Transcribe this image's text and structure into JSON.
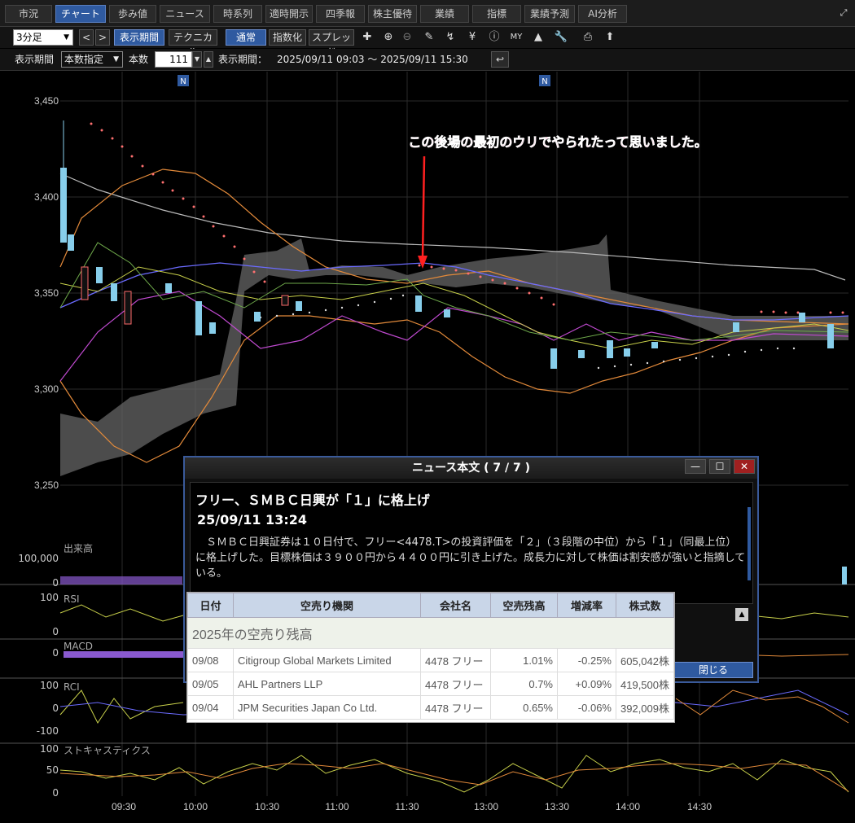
{
  "tabs": [
    "市況",
    "チャート",
    "歩み値",
    "ニュース",
    "時系列",
    "適時開示",
    "四季報",
    "株主優待",
    "業績",
    "指標",
    "業績予測",
    "AI分析"
  ],
  "active_tab": "チャート",
  "toolbar": {
    "interval": "3分足",
    "prev": "<",
    "next": ">",
    "period_btn": "表示期間",
    "technical_btn": "テクニカル",
    "normal_btn": "通常",
    "index_btn": "指数化",
    "spread_btn": "スプレッド"
  },
  "period_row": {
    "period_label": "表示期間",
    "mode": "本数指定",
    "count_label": "本数",
    "count_value": "111",
    "range_label": "表示期間：",
    "range_value": "2025/09/11 09:03 〜 2025/09/11 15:30"
  },
  "annotation": "この後場の最初のウリでやられたって思いました。",
  "news_marker": "N",
  "price_axis": {
    "ticks": [
      "3,450",
      "3,400",
      "3,350",
      "3,300",
      "3,250"
    ]
  },
  "panels": {
    "volume": {
      "label": "出来高",
      "ticks": [
        "100,000",
        "0"
      ]
    },
    "rsi": {
      "label": "RSI",
      "ticks": [
        "100",
        "0"
      ]
    },
    "macd": {
      "label": "MACD",
      "ticks": [
        "0"
      ]
    },
    "rci": {
      "label": "RCI",
      "ticks": [
        "100",
        "0",
        "-100"
      ]
    },
    "stoch": {
      "label": "ストキャスティクス",
      "ticks": [
        "100",
        "50",
        "0"
      ]
    }
  },
  "time_axis": [
    "09:30",
    "10:00",
    "10:30",
    "11:00",
    "11:30",
    "13:00",
    "13:30",
    "14:00",
    "14:30"
  ],
  "news": {
    "title": "ニュース本文 ( 7 / 7 )",
    "headline": "フリー、ＳＭＢＣ日興が「１」に格上げ",
    "date": "25/09/11 13:24",
    "body": "　ＳＭＢＣ日興証券は１０日付で、フリー<4478.T>の投資評価を「２」（３段階の中位）から「１」（同最上位）に格上げした。目標株価は３９００円から４４００円に引き上げた。成長力に対して株価は割安感が強いと指摘している。",
    "close": "閉じる",
    "min": "—",
    "max": "☐",
    "x": "✕"
  },
  "short_table": {
    "headers": [
      "日付",
      "空売り機関",
      "会社名",
      "空売残高",
      "増減率",
      "株式数"
    ],
    "year_row": "2025年の空売り残高",
    "rows": [
      {
        "date": "09/08",
        "inst": "Citigroup Global Markets Limited",
        "company": "4478 フリー",
        "ratio": "1.01%",
        "change": "-0.25%",
        "shares": "605,042株"
      },
      {
        "date": "09/05",
        "inst": "AHL Partners LLP",
        "company": "4478 フリー",
        "ratio": "0.7%",
        "change": "+0.09%",
        "shares": "419,500株"
      },
      {
        "date": "09/04",
        "inst": "JPM Securities Japan Co Ltd.",
        "company": "4478 フリー",
        "ratio": "0.65%",
        "change": "-0.06%",
        "shares": "392,009株"
      }
    ]
  }
}
